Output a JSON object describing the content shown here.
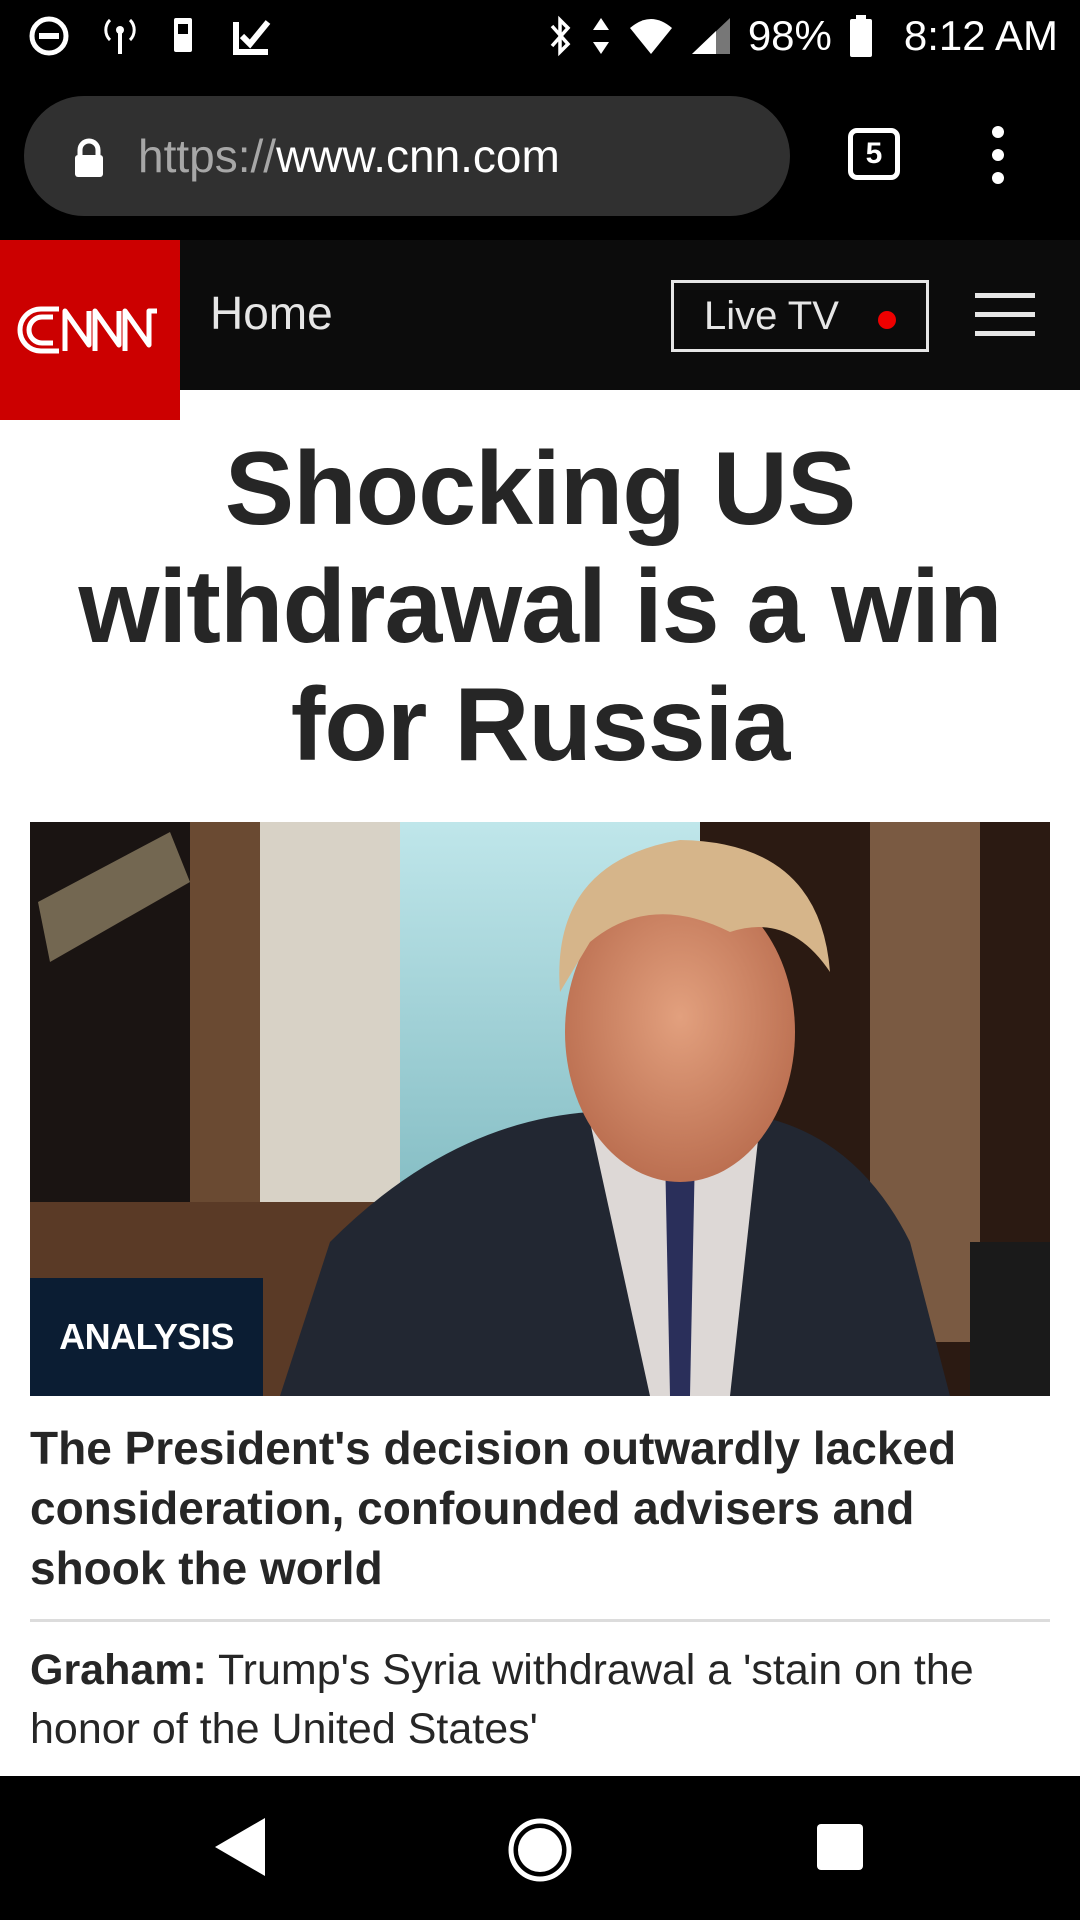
{
  "status_bar": {
    "battery": "98%",
    "time": "8:12 AM",
    "icons_left": [
      "do-not-disturb-icon",
      "hotspot-icon",
      "sim-icon",
      "checklist-icon"
    ],
    "icons_right": [
      "bluetooth-icon",
      "data-arrows-icon",
      "wifi-icon",
      "signal-icon",
      "battery-icon"
    ]
  },
  "browser": {
    "url_scheme": "https://",
    "url_host": "www.cnn.com",
    "tab_count": "5"
  },
  "site_header": {
    "logo_text": "CNN",
    "section": "Home",
    "live_tv": "Live TV",
    "live_dot_color": "#ee0000",
    "brand_color": "#cc0000"
  },
  "article": {
    "headline": "Shocking US withdrawal is a win for Russia",
    "badge": "ANALYSIS",
    "subheadline": "The President's decision outwardly lacked consideration, confounded advisers and shook the world",
    "related_label": "Graham:",
    "related_text": " Trump's Syria withdrawal a 'stain on the honor of the United States'"
  },
  "nav_bar": {
    "buttons": [
      "back-icon",
      "home-icon",
      "recents-icon"
    ]
  }
}
